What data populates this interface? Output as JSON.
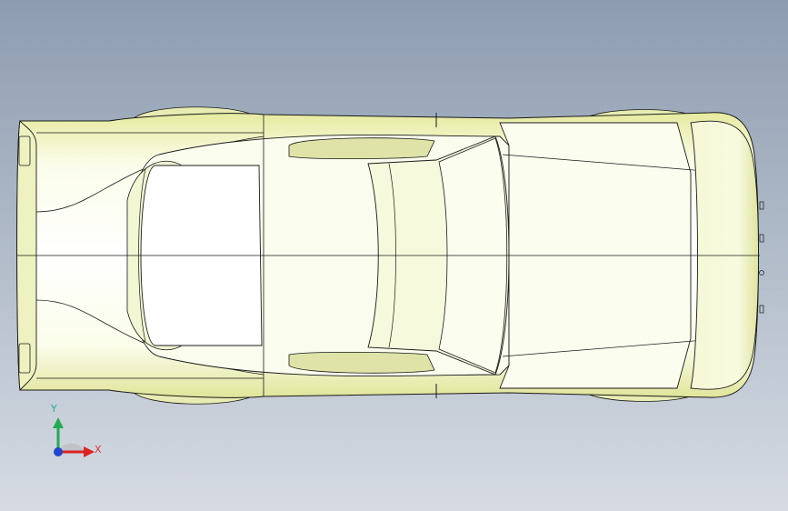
{
  "viewport": {
    "background_top": "#8d9cb0",
    "background_bottom": "#d6dbe3"
  },
  "model": {
    "body_color": "#f3f6c9",
    "shade_color": "#d8dc98",
    "edge_color": "#1a1a1a"
  },
  "triad": {
    "x_label": "X",
    "y_label": "Y",
    "x_color": "#dd2222",
    "y_color": "#22aa55",
    "z_color": "#2244cc"
  }
}
